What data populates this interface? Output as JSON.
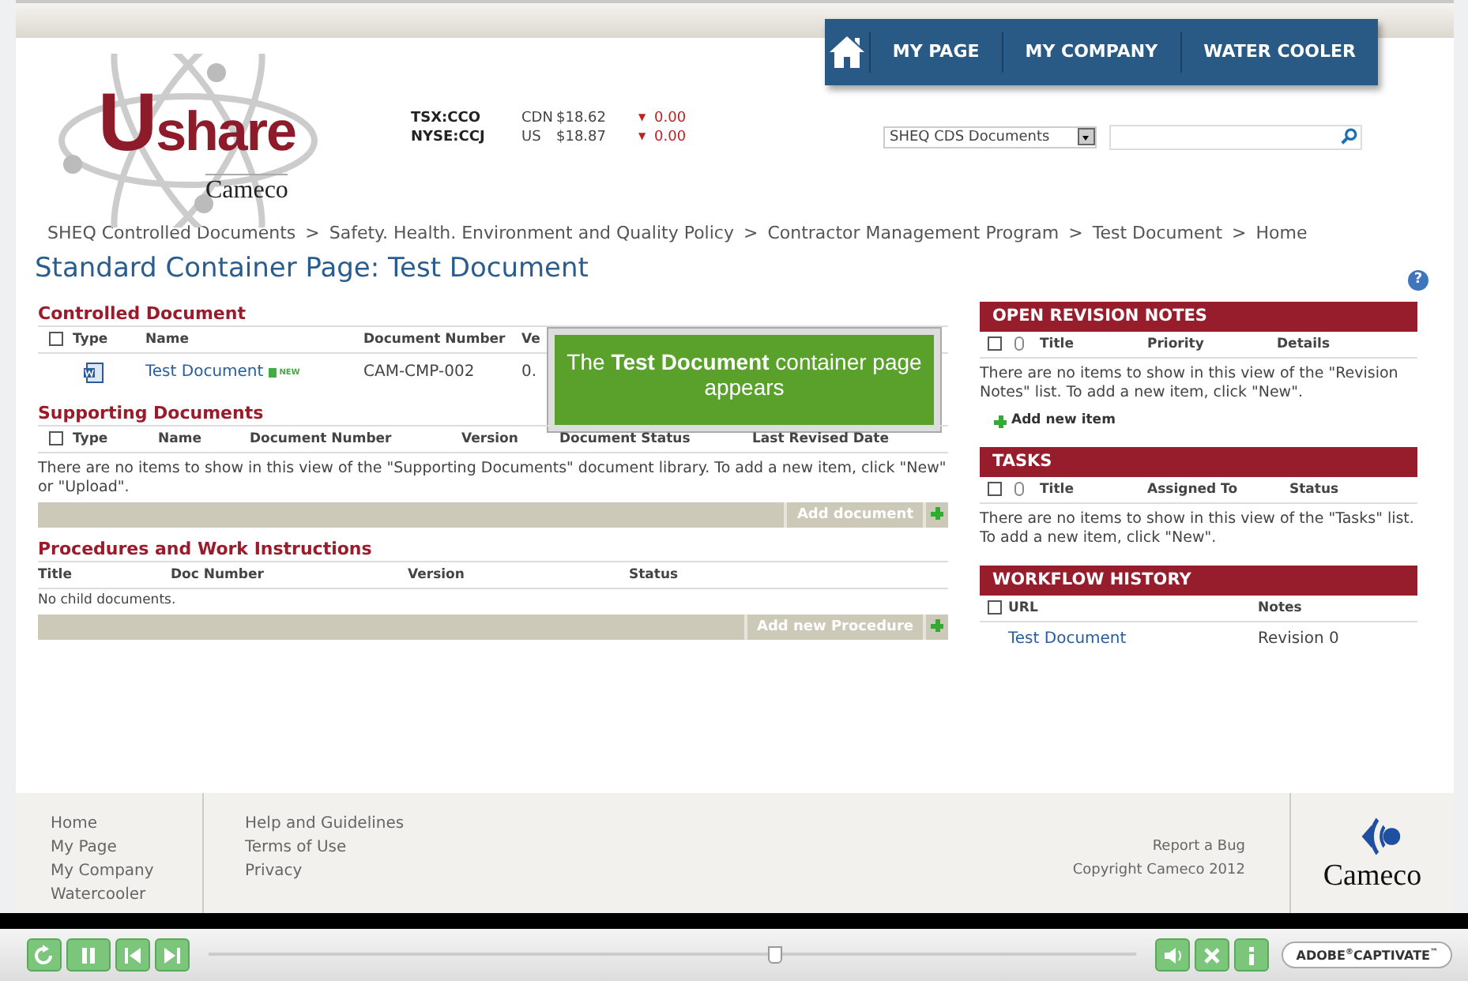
{
  "top_nav": {
    "items": [
      "MY PAGE",
      "MY COMPANY",
      "WATER COOLER"
    ]
  },
  "logo": {
    "name": "Ushare",
    "company": "Cameco"
  },
  "stocks": [
    {
      "symbol": "TSX:CCO",
      "currency": "CDN",
      "price": "$18.62",
      "arrow": "▼",
      "change": "0.00"
    },
    {
      "symbol": "NYSE:CCJ",
      "currency": "US",
      "price": "$18.87",
      "arrow": "▼",
      "change": "0.00"
    }
  ],
  "search": {
    "scope": "SHEQ CDS Documents"
  },
  "breadcrumb_separator": ">",
  "breadcrumb": [
    "SHEQ Controlled Documents",
    "Safety. Health. Environment and Quality Policy",
    "Contractor Management Program",
    "Test Document",
    "Home"
  ],
  "page_title": "Standard Container Page: Test Document",
  "help": "?",
  "controlled_document": {
    "title": "Controlled Document",
    "checked": false,
    "columns": [
      "Type",
      "Name",
      "Document Number",
      "Ve"
    ],
    "rows": [
      {
        "name": "Test Document",
        "badge": "NEW",
        "number": "CAM-CMP-002",
        "version": "0."
      }
    ]
  },
  "callout": "The **Test Document** container page appears",
  "supporting_documents": {
    "title": "Supporting Documents",
    "checked": false,
    "columns": [
      "Type",
      "Name",
      "Document Number",
      "Version",
      "Document Status",
      "Last Revised Date"
    ],
    "message": "There are no items to show in this view of the \"Supporting Documents\" document library. To add a new item, click \"New\" or \"Upload\".",
    "action": "Add document"
  },
  "procedures": {
    "title": "Procedures and Work Instructions",
    "columns": [
      "Title",
      "Doc Number",
      "Version",
      "Status"
    ],
    "message": "No child documents.",
    "action": "Add new Procedure"
  },
  "revision_notes": {
    "title": "OPEN REVISION NOTES",
    "checked": false,
    "columns": [
      "Title",
      "Priority",
      "Details"
    ],
    "message": "There are no items to show in this view of the \"Revision Notes\" list. To add a new item, click \"New\".",
    "add_link": "Add new item"
  },
  "tasks": {
    "title": "TASKS",
    "checked": false,
    "columns": [
      "Title",
      "Assigned To",
      "Status"
    ],
    "message": "There are no items to show in this view of the \"Tasks\" list. To add a new item, click \"New\"."
  },
  "workflow_history": {
    "title": "WORKFLOW HISTORY",
    "checked": false,
    "columns": [
      "URL",
      "Notes"
    ],
    "rows": [
      {
        "url": "Test Document",
        "notes": "Revision 0"
      }
    ]
  },
  "footer": {
    "nav_links": [
      "Home",
      "My Page",
      "My Company",
      "Watercooler"
    ],
    "info_links": [
      "Help and Guidelines",
      "Terms of Use",
      "Privacy"
    ],
    "report": "Report a Bug",
    "copyright": "Copyright Cameco 2012",
    "logo": "Cameco"
  },
  "player": {
    "level": 0.61,
    "brand": "ADOBE$^{®}$CAPTIVATE$^{™}$"
  }
}
